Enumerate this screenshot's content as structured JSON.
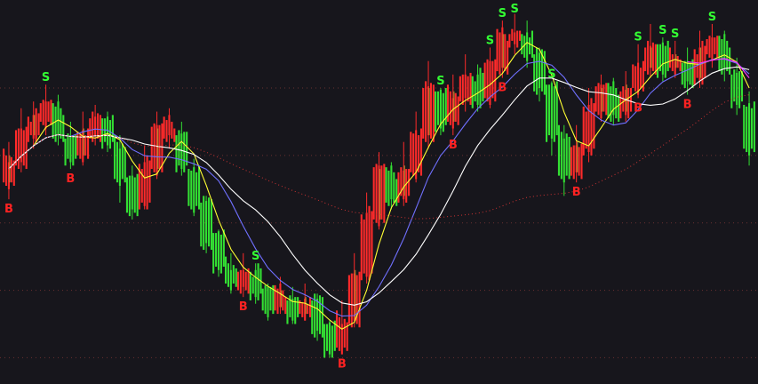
{
  "chart_data": {
    "type": "candlestick",
    "y_reference_levels": [
      0,
      0.2,
      0.4,
      0.6,
      0.8
    ],
    "grid": "horizontal dotted",
    "bars": [
      {
        "d": 1,
        "o": 0.52,
        "c": 0.6,
        "h": 0.64,
        "l": 0.47
      },
      {
        "d": 1,
        "o": 0.58,
        "c": 0.69,
        "h": 0.74,
        "l": 0.55
      },
      {
        "d": 1,
        "o": 0.66,
        "c": 0.72,
        "h": 0.76,
        "l": 0.62
      },
      {
        "d": 1,
        "o": 0.7,
        "c": 0.75,
        "h": 0.81,
        "l": 0.66
      },
      {
        "d": -1,
        "o": 0.74,
        "c": 0.66,
        "h": 0.78,
        "l": 0.63
      },
      {
        "d": -1,
        "o": 0.67,
        "c": 0.59,
        "h": 0.7,
        "l": 0.56
      },
      {
        "d": 1,
        "o": 0.6,
        "c": 0.68,
        "h": 0.73,
        "l": 0.57
      },
      {
        "d": 1,
        "o": 0.66,
        "c": 0.71,
        "h": 0.75,
        "l": 0.63
      },
      {
        "d": -1,
        "o": 0.7,
        "c": 0.64,
        "h": 0.73,
        "l": 0.61
      },
      {
        "d": -1,
        "o": 0.64,
        "c": 0.53,
        "h": 0.66,
        "l": 0.46
      },
      {
        "d": -1,
        "o": 0.55,
        "c": 0.44,
        "h": 0.57,
        "l": 0.41
      },
      {
        "d": 1,
        "o": 0.46,
        "c": 0.58,
        "h": 0.63,
        "l": 0.44
      },
      {
        "d": 1,
        "o": 0.56,
        "c": 0.68,
        "h": 0.73,
        "l": 0.53
      },
      {
        "d": 1,
        "o": 0.66,
        "c": 0.7,
        "h": 0.74,
        "l": 0.62
      },
      {
        "d": -1,
        "o": 0.68,
        "c": 0.57,
        "h": 0.7,
        "l": 0.54
      },
      {
        "d": -1,
        "o": 0.57,
        "c": 0.45,
        "h": 0.59,
        "l": 0.42
      },
      {
        "d": -1,
        "o": 0.46,
        "c": 0.34,
        "h": 0.48,
        "l": 0.31
      },
      {
        "d": -1,
        "o": 0.36,
        "c": 0.27,
        "h": 0.38,
        "l": 0.24
      },
      {
        "d": -1,
        "o": 0.28,
        "c": 0.22,
        "h": 0.31,
        "l": 0.19
      },
      {
        "d": 1,
        "o": 0.21,
        "c": 0.27,
        "h": 0.31,
        "l": 0.18
      },
      {
        "d": -1,
        "o": 0.26,
        "c": 0.19,
        "h": 0.28,
        "l": 0.16
      },
      {
        "d": -1,
        "o": 0.2,
        "c": 0.14,
        "h": 0.22,
        "l": 0.11
      },
      {
        "d": 1,
        "o": 0.15,
        "c": 0.2,
        "h": 0.24,
        "l": 0.13
      },
      {
        "d": -1,
        "o": 0.19,
        "c": 0.12,
        "h": 0.21,
        "l": 0.1
      },
      {
        "d": 1,
        "o": 0.13,
        "c": 0.18,
        "h": 0.22,
        "l": 0.11
      },
      {
        "d": -1,
        "o": 0.17,
        "c": 0.08,
        "h": 0.19,
        "l": 0.05
      },
      {
        "d": -1,
        "o": 0.09,
        "c": 0.02,
        "h": 0.11,
        "l": 0.0
      },
      {
        "d": 1,
        "o": 0.03,
        "c": 0.12,
        "h": 0.17,
        "l": 0.01
      },
      {
        "d": 1,
        "o": 0.11,
        "c": 0.26,
        "h": 0.31,
        "l": 0.09
      },
      {
        "d": 1,
        "o": 0.25,
        "c": 0.43,
        "h": 0.49,
        "l": 0.22
      },
      {
        "d": 1,
        "o": 0.41,
        "c": 0.56,
        "h": 0.61,
        "l": 0.38
      },
      {
        "d": -1,
        "o": 0.55,
        "c": 0.47,
        "h": 0.58,
        "l": 0.44
      },
      {
        "d": 1,
        "o": 0.48,
        "c": 0.57,
        "h": 0.64,
        "l": 0.45
      },
      {
        "d": 1,
        "o": 0.55,
        "c": 0.68,
        "h": 0.73,
        "l": 0.52
      },
      {
        "d": 1,
        "o": 0.66,
        "c": 0.8,
        "h": 0.88,
        "l": 0.62
      },
      {
        "d": -1,
        "o": 0.78,
        "c": 0.69,
        "h": 0.8,
        "l": 0.66
      },
      {
        "d": 1,
        "o": 0.7,
        "c": 0.79,
        "h": 0.84,
        "l": 0.66
      },
      {
        "d": 1,
        "o": 0.77,
        "c": 0.85,
        "h": 0.9,
        "l": 0.73
      },
      {
        "d": -1,
        "o": 0.84,
        "c": 0.76,
        "h": 0.87,
        "l": 0.73
      },
      {
        "d": 1,
        "o": 0.77,
        "c": 0.87,
        "h": 0.92,
        "l": 0.74
      },
      {
        "d": 1,
        "o": 0.86,
        "c": 0.96,
        "h": 1.0,
        "l": 0.83
      },
      {
        "d": 1,
        "o": 0.94,
        "c": 0.98,
        "h": 1.02,
        "l": 0.9
      },
      {
        "d": -1,
        "o": 0.97,
        "c": 0.9,
        "h": 1.0,
        "l": 0.86
      },
      {
        "d": -1,
        "o": 0.9,
        "c": 0.8,
        "h": 0.92,
        "l": 0.76
      },
      {
        "d": -1,
        "o": 0.8,
        "c": 0.66,
        "h": 0.82,
        "l": 0.6
      },
      {
        "d": -1,
        "o": 0.67,
        "c": 0.54,
        "h": 0.69,
        "l": 0.48
      },
      {
        "d": 1,
        "o": 0.55,
        "c": 0.64,
        "h": 0.69,
        "l": 0.52
      },
      {
        "d": 1,
        "o": 0.62,
        "c": 0.75,
        "h": 0.8,
        "l": 0.58
      },
      {
        "d": 1,
        "o": 0.73,
        "c": 0.8,
        "h": 0.84,
        "l": 0.7
      },
      {
        "d": -1,
        "o": 0.8,
        "c": 0.72,
        "h": 0.83,
        "l": 0.69
      },
      {
        "d": 1,
        "o": 0.73,
        "c": 0.81,
        "h": 0.85,
        "l": 0.7
      },
      {
        "d": 1,
        "o": 0.8,
        "c": 0.88,
        "h": 0.93,
        "l": 0.77
      },
      {
        "d": 1,
        "o": 0.86,
        "c": 0.92,
        "h": 0.99,
        "l": 0.83
      },
      {
        "d": -1,
        "o": 0.92,
        "c": 0.85,
        "h": 0.95,
        "l": 0.82
      },
      {
        "d": 1,
        "o": 0.86,
        "c": 0.9,
        "h": 0.94,
        "l": 0.83
      },
      {
        "d": -1,
        "o": 0.89,
        "c": 0.82,
        "h": 0.92,
        "l": 0.78
      },
      {
        "d": 1,
        "o": 0.83,
        "c": 0.92,
        "h": 0.97,
        "l": 0.8
      },
      {
        "d": 1,
        "o": 0.9,
        "c": 0.94,
        "h": 0.99,
        "l": 0.86
      },
      {
        "d": -1,
        "o": 0.94,
        "c": 0.86,
        "h": 0.97,
        "l": 0.82
      },
      {
        "d": -1,
        "o": 0.86,
        "c": 0.76,
        "h": 0.89,
        "l": 0.72
      },
      {
        "d": -1,
        "o": 0.76,
        "c": 0.62,
        "h": 0.79,
        "l": 0.57
      }
    ],
    "lines": [
      {
        "color": "#ffff33",
        "period": 3
      },
      {
        "color": "#7070ff",
        "period": 6
      },
      {
        "color": "#ffffff",
        "period": 10
      },
      {
        "color": "#cc3333",
        "period": 30,
        "dashed": true
      },
      {
        "color": "#ff33ff",
        "period": 4,
        "segment": "tail"
      }
    ],
    "signals": [
      {
        "label": "S",
        "bar": 3,
        "color": "#33ff33"
      },
      {
        "label": "B",
        "bar": 0,
        "color": "#ff2222"
      },
      {
        "label": "B",
        "bar": 5,
        "color": "#ff2222"
      },
      {
        "label": "B",
        "bar": 19,
        "color": "#ff2222"
      },
      {
        "label": "S",
        "bar": 20,
        "color": "#33ff33"
      },
      {
        "label": "B",
        "bar": 27,
        "color": "#ff2222"
      },
      {
        "label": "S",
        "bar": 35,
        "color": "#33ff33"
      },
      {
        "label": "B",
        "bar": 36,
        "color": "#ff2222"
      },
      {
        "label": "S",
        "bar": 39,
        "color": "#33ff33"
      },
      {
        "label": "S",
        "bar": 40,
        "color": "#33ff33"
      },
      {
        "label": "B",
        "bar": 40,
        "color": "#ff2222"
      },
      {
        "label": "S",
        "bar": 41,
        "color": "#33ff33"
      },
      {
        "label": "S",
        "bar": 44,
        "color": "#33ff33"
      },
      {
        "label": "B",
        "bar": 46,
        "color": "#ff2222"
      },
      {
        "label": "S",
        "bar": 51,
        "color": "#33ff33"
      },
      {
        "label": "B",
        "bar": 51,
        "color": "#ff2222"
      },
      {
        "label": "S",
        "bar": 53,
        "color": "#33ff33"
      },
      {
        "label": "S",
        "bar": 54,
        "color": "#33ff33"
      },
      {
        "label": "B",
        "bar": 55,
        "color": "#ff2222"
      },
      {
        "label": "S",
        "bar": 57,
        "color": "#33ff33"
      }
    ],
    "colors": {
      "up": "#ff2a2a",
      "down": "#33e033",
      "grid": "#6a3030",
      "background": "#17161c"
    }
  }
}
